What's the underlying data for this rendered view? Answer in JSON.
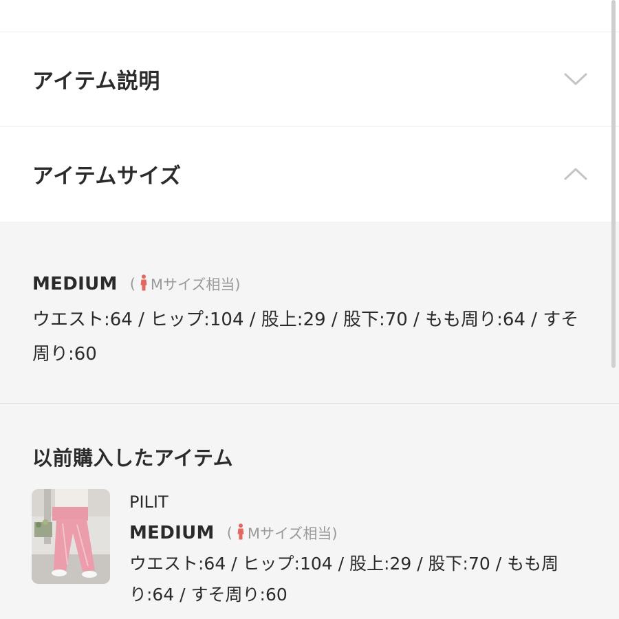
{
  "accordions": {
    "description": {
      "title": "アイテム説明",
      "icon": "chevron-down-icon"
    },
    "size": {
      "title": "アイテムサイズ",
      "icon": "chevron-up-icon"
    }
  },
  "size_panel": {
    "name": "MEDIUM",
    "equiv_open": "(",
    "equiv_text": "Mサイズ相当)",
    "equiv_icon": "person-icon",
    "measurements": "ウエスト:64 / ヒップ:104 / 股上:29 / 股下:70 / もも周り:64 / すそ周り:60"
  },
  "history": {
    "title": "以前購入したアイテム",
    "item": {
      "brand": "PILIT",
      "size": "MEDIUM",
      "equiv_open": "(",
      "equiv_text": "Mサイズ相当)",
      "measurements": "ウエスト:64 / ヒップ:104 / 股上:29 / 股下:70 / もも周り:64 / すそ周り:60"
    }
  },
  "colors": {
    "accent_person": "#e3685f",
    "panel_bg": "#f5f5f5",
    "chevron": "#c4c4c4"
  }
}
